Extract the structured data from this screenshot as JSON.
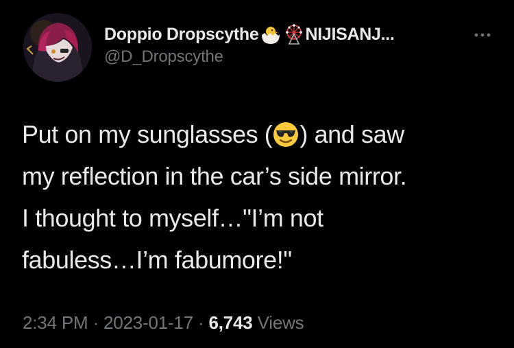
{
  "author": {
    "display_name": "Doppio Dropscythe",
    "name_suffix": "NIJISANJ...",
    "handle": "@D_Dropscythe",
    "icons": [
      "hatching-chick-icon",
      "ferris-wheel-icon"
    ]
  },
  "tweet": {
    "text_before_emoji": "Put on my sunglasses (",
    "emoji": "smiling-face-with-sunglasses-icon",
    "text_after_emoji": ") and saw",
    "line2": "my reflection in the car’s side mirror.",
    "line3": "I thought to myself…\"I’m not",
    "line4": "fabuless…I’m fabumore!\""
  },
  "meta": {
    "time": "2:34 PM",
    "sep1": " · ",
    "date": "2023-01-17",
    "sep2": " · ",
    "views_count": "6,743",
    "views_label": " Views"
  },
  "colors": {
    "background": "#000000",
    "text_primary": "#e7e9ea",
    "text_secondary": "#71767b"
  }
}
